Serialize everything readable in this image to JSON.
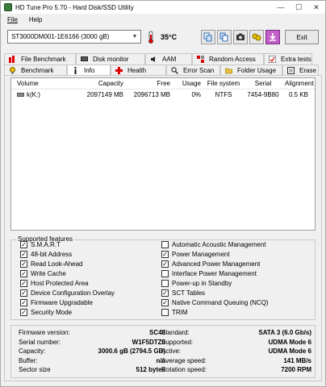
{
  "window": {
    "title": "HD Tune Pro 5.70 - Hard Disk/SSD Utility",
    "minimize": "—",
    "maximize": "☐",
    "close": "✕"
  },
  "menu": {
    "file": "File",
    "help": "Help"
  },
  "toolbar": {
    "drive": "ST3000DM001-1E6166 (3000 gB)",
    "temperature": "35°C",
    "exit": "Exit"
  },
  "tabs_top": [
    "File Benchmark",
    "Disk monitor",
    "AAM",
    "Random Access",
    "Extra tests"
  ],
  "tabs_bottom": [
    "Benchmark",
    "Info",
    "Health",
    "Error Scan",
    "Folder Usage",
    "Erase"
  ],
  "table": {
    "headers": [
      "Volume",
      "Capacity",
      "Free",
      "Usage",
      "File system",
      "Serial",
      "Alignment"
    ],
    "rows": [
      [
        "k(K:)",
        "2097149 MB",
        "2096713 MB",
        "0%",
        "NTFS",
        "7454-9B80",
        "0.5 KB"
      ]
    ]
  },
  "features": {
    "title": "Supported features",
    "left": [
      {
        "label": "S.M.A.R.T",
        "checked": true
      },
      {
        "label": "48-bit Address",
        "checked": true
      },
      {
        "label": "Read Look-Ahead",
        "checked": true
      },
      {
        "label": "Write Cache",
        "checked": true
      },
      {
        "label": "Host Protected Area",
        "checked": true
      },
      {
        "label": "Device Configuration Overlay",
        "checked": true
      },
      {
        "label": "Firmware Upgradable",
        "checked": true
      },
      {
        "label": "Security Mode",
        "checked": true
      }
    ],
    "right": [
      {
        "label": "Automatic Acoustic Management",
        "checked": false
      },
      {
        "label": "Power Management",
        "checked": true
      },
      {
        "label": "Advanced Power Management",
        "checked": true
      },
      {
        "label": "Interface Power Management",
        "checked": false
      },
      {
        "label": "Power-up in Standby",
        "checked": false
      },
      {
        "label": "SCT Tables",
        "checked": true
      },
      {
        "label": "Native Command Queuing (NCQ)",
        "checked": true
      },
      {
        "label": "TRIM",
        "checked": false
      }
    ]
  },
  "info": {
    "left": [
      {
        "label": "Firmware version:",
        "value": "SC48"
      },
      {
        "label": "Serial number:",
        "value": "W1F5DTZ0"
      },
      {
        "label": "Capacity:",
        "value": "3000.6 gB (2794.5 GB)"
      },
      {
        "label": "Buffer:",
        "value": "n/a"
      },
      {
        "label": "Sector size",
        "value": "512 bytes"
      }
    ],
    "right": [
      {
        "label": "Standard:",
        "value": "SATA 3 (6.0 Gb/s)"
      },
      {
        "label": "Supported:",
        "value": "UDMA Mode 6"
      },
      {
        "label": "Active:",
        "value": "UDMA Mode 6"
      },
      {
        "label": "Average speed:",
        "value": "141 MB/s"
      },
      {
        "label": "Rotation speed:",
        "value": "7200 RPM"
      }
    ]
  }
}
